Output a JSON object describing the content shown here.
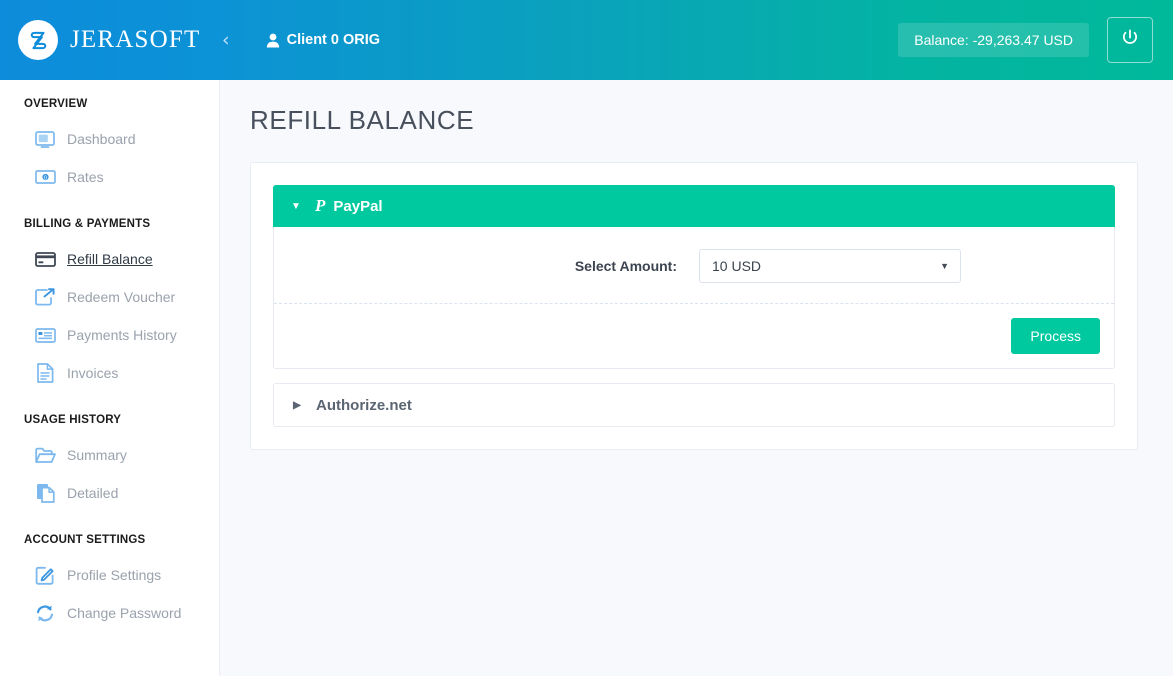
{
  "header": {
    "brand_name": "JERASOFT",
    "brand_icon": "jerasoft-logo-icon",
    "collapse_icon": "chevron-left-icon",
    "user_icon": "user-icon",
    "client_label": "Client 0 ORIG",
    "balance_label": "Balance: -29,263.47 USD",
    "logout_icon": "power-icon",
    "gradient_from": "#0d8cdb",
    "gradient_to": "#00b89a"
  },
  "sidebar": {
    "sections": [
      {
        "title": "OVERVIEW",
        "items": [
          {
            "label": "Dashboard",
            "icon": "monitor-icon",
            "active": false
          },
          {
            "label": "Rates",
            "icon": "banknote-icon",
            "active": false
          }
        ]
      },
      {
        "title": "BILLING & PAYMENTS",
        "items": [
          {
            "label": "Refill Balance",
            "icon": "credit-card-icon",
            "active": true
          },
          {
            "label": "Redeem Voucher",
            "icon": "share-export-icon",
            "active": false
          },
          {
            "label": "Payments History",
            "icon": "list-table-icon",
            "active": false
          },
          {
            "label": "Invoices",
            "icon": "document-icon",
            "active": false
          }
        ]
      },
      {
        "title": "USAGE HISTORY",
        "items": [
          {
            "label": "Summary",
            "icon": "open-folder-icon",
            "active": false
          },
          {
            "label": "Detailed",
            "icon": "copy-pages-icon",
            "active": false
          }
        ]
      },
      {
        "title": "ACCOUNT SETTINGS",
        "items": [
          {
            "label": "Profile Settings",
            "icon": "edit-pencil-square-icon",
            "active": false
          },
          {
            "label": "Change Password",
            "icon": "refresh-cycle-icon",
            "active": false
          }
        ]
      }
    ]
  },
  "main": {
    "page_title": "REFILL BALANCE",
    "accent_color": "#00c9a0",
    "accordions": [
      {
        "id": "paypal",
        "title": "PayPal",
        "brand_glyph": "P",
        "expanded": true,
        "caret_icon": "caret-down-icon",
        "form": {
          "amount_label": "Select Amount:",
          "amount_value": "10 USD",
          "amount_options": [
            "10 USD"
          ],
          "select_caret_icon": "caret-down-icon"
        },
        "submit_label": "Process"
      },
      {
        "id": "authorize-net",
        "title": "Authorize.net",
        "expanded": false,
        "caret_icon": "caret-right-icon"
      }
    ]
  }
}
